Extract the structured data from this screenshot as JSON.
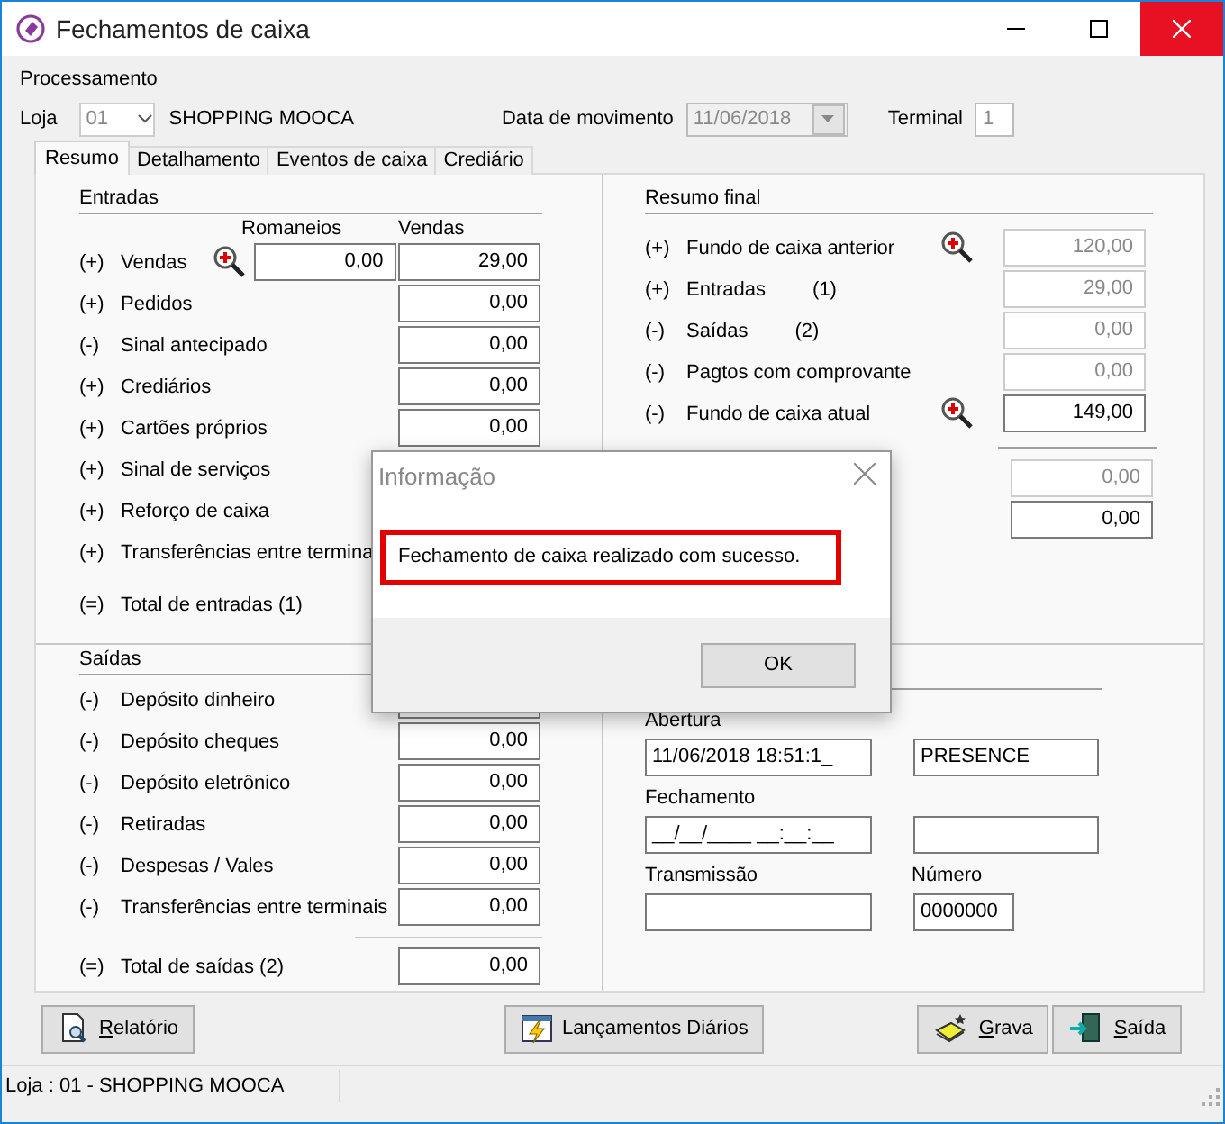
{
  "window": {
    "title": "Fechamentos de caixa"
  },
  "processing": {
    "title": "Processamento",
    "store_label": "Loja",
    "store_code": "01",
    "store_code_disabled": true,
    "store_name": "SHOPPING MOOCA",
    "date_label": "Data de movimento",
    "date": "11/06/2018",
    "date_disabled": true,
    "terminal_label": "Terminal",
    "terminal": "1"
  },
  "tabs": [
    {
      "label": "Resumo",
      "selected": true
    },
    {
      "label": "Detalhamento",
      "selected": false
    },
    {
      "label": "Eventos de caixa",
      "selected": false
    },
    {
      "label": "Crediário",
      "selected": false
    }
  ],
  "entries": {
    "title": "Entradas",
    "columns": [
      "Romaneios",
      "Vendas"
    ],
    "rows": [
      {
        "sign": "(+)",
        "label": "Vendas",
        "zoom": true,
        "romaneios": "0,00",
        "value": "29,00"
      },
      {
        "sign": "(+)",
        "label": "Pedidos",
        "zoom": false,
        "value": "0,00"
      },
      {
        "sign": "(-)",
        "label": "Sinal antecipado",
        "zoom": false,
        "value": "0,00"
      },
      {
        "sign": "(+)",
        "label": "Crediários",
        "zoom": false,
        "value": "0,00"
      },
      {
        "sign": "(+)",
        "label": "Cartões próprios",
        "zoom": false,
        "value": "0,00"
      },
      {
        "sign": "(+)",
        "label": "Sinal de serviços",
        "zoom": false
      },
      {
        "sign": "(+)",
        "label": "Reforço de caixa",
        "zoom": false
      },
      {
        "sign": "(+)",
        "label": "Transferências entre termina",
        "zoom": false
      }
    ],
    "total": {
      "sign": "(=)",
      "label": "Total de entradas (1)"
    }
  },
  "exits": {
    "title": "Saídas",
    "rows": [
      {
        "sign": "(-)",
        "label": "Depósito dinheiro"
      },
      {
        "sign": "(-)",
        "label": "Depósito cheques",
        "value": "0,00"
      },
      {
        "sign": "(-)",
        "label": "Depósito eletrônico",
        "value": "0,00"
      },
      {
        "sign": "(-)",
        "label": "Retiradas",
        "value": "0,00"
      },
      {
        "sign": "(-)",
        "label": "Despesas / Vales",
        "value": "0,00"
      },
      {
        "sign": "(-)",
        "label": "Transferências entre terminais",
        "value": "0,00"
      }
    ],
    "total": {
      "sign": "(=)",
      "label": "Total de saídas (2)",
      "value": "0,00"
    }
  },
  "final": {
    "title": "Resumo final",
    "rows": [
      {
        "sign": "(+)",
        "label": "Fundo de caixa anterior",
        "zoom": true,
        "value": "120,00",
        "disabled": true
      },
      {
        "sign": "(+)",
        "label": "Entradas",
        "note": "(1)",
        "zoom": false,
        "value": "29,00",
        "disabled": true
      },
      {
        "sign": "(-)",
        "label": "Saídas",
        "note": "(2)",
        "zoom": false,
        "value": "0,00",
        "disabled": true
      },
      {
        "sign": "(-)",
        "label": "Pagtos com comprovante",
        "zoom": false,
        "value": "0,00",
        "disabled": true
      },
      {
        "sign": "(-)",
        "label": "Fundo de caixa atual",
        "zoom": true,
        "value": "149,00",
        "disabled": false
      }
    ],
    "extra": [
      {
        "value": "0,00",
        "disabled": true
      },
      {
        "value": "0,00",
        "disabled": false
      }
    ]
  },
  "times": {
    "opening_label": "Abertura",
    "opening": "11/06/2018 18:51:1_",
    "opening_user": "PRESENCE",
    "closing_label": "Fechamento",
    "closing": "__/__/____ __:__:__",
    "transmission_label": "Transmissão",
    "number_label": "Número",
    "number": "0000000"
  },
  "buttons": [
    {
      "label": "Relatório",
      "kind": "report",
      "underline_first": true
    },
    {
      "label": "Lançamentos Diários",
      "kind": "entries",
      "underline_first": false
    },
    {
      "label": "Grava",
      "kind": "save",
      "underline_first": true
    },
    {
      "label": "Saída",
      "kind": "exit",
      "underline_first": true
    }
  ],
  "status_bar": {
    "text": "Loja : 01 - SHOPPING MOOCA"
  },
  "dialog": {
    "title": "Informação",
    "message": "Fechamento de caixa realizado com sucesso.",
    "highlighted": true,
    "button": "OK"
  }
}
